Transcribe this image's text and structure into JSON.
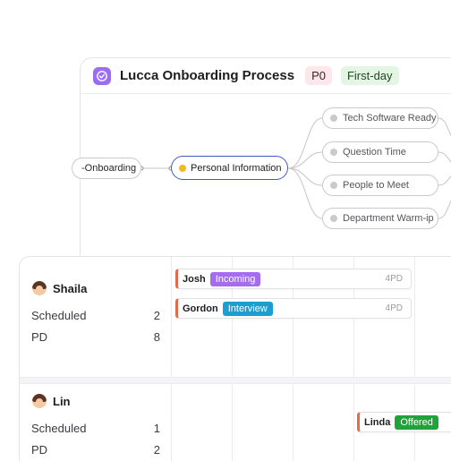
{
  "process": {
    "title": "Lucca Onboarding Process",
    "priority": "P0",
    "stage": "First-day",
    "badge_icon": "check-circle-icon",
    "parent_node": "-Onboarding",
    "current_node": "Personal Information",
    "children": [
      "Tech Software Ready",
      "Question Time",
      "People to Meet",
      "Department Warm-ip"
    ]
  },
  "board": {
    "people": [
      {
        "name": "Shaila",
        "scheduled_label": "Scheduled",
        "scheduled_value": "2",
        "pd_label": "PD",
        "pd_value": "8",
        "tasks": [
          {
            "who": "Josh",
            "status": "Incoming",
            "status_color": "#a66cf0",
            "pd": "4PD"
          },
          {
            "who": "Gordon",
            "status": "Interview",
            "status_color": "#1c9ed3",
            "pd": "4PD"
          }
        ]
      },
      {
        "name": "Lin",
        "scheduled_label": "Scheduled",
        "scheduled_value": "1",
        "pd_label": "PD",
        "pd_value": "2",
        "tasks": [
          {
            "who": "Linda",
            "status": "Offered",
            "status_color": "#1fa33a",
            "pd": ""
          }
        ]
      }
    ]
  },
  "colors": {
    "accent": "#3f59c9",
    "task_edge": "#e5694b",
    "brand_badge": "#9b6cf5"
  }
}
